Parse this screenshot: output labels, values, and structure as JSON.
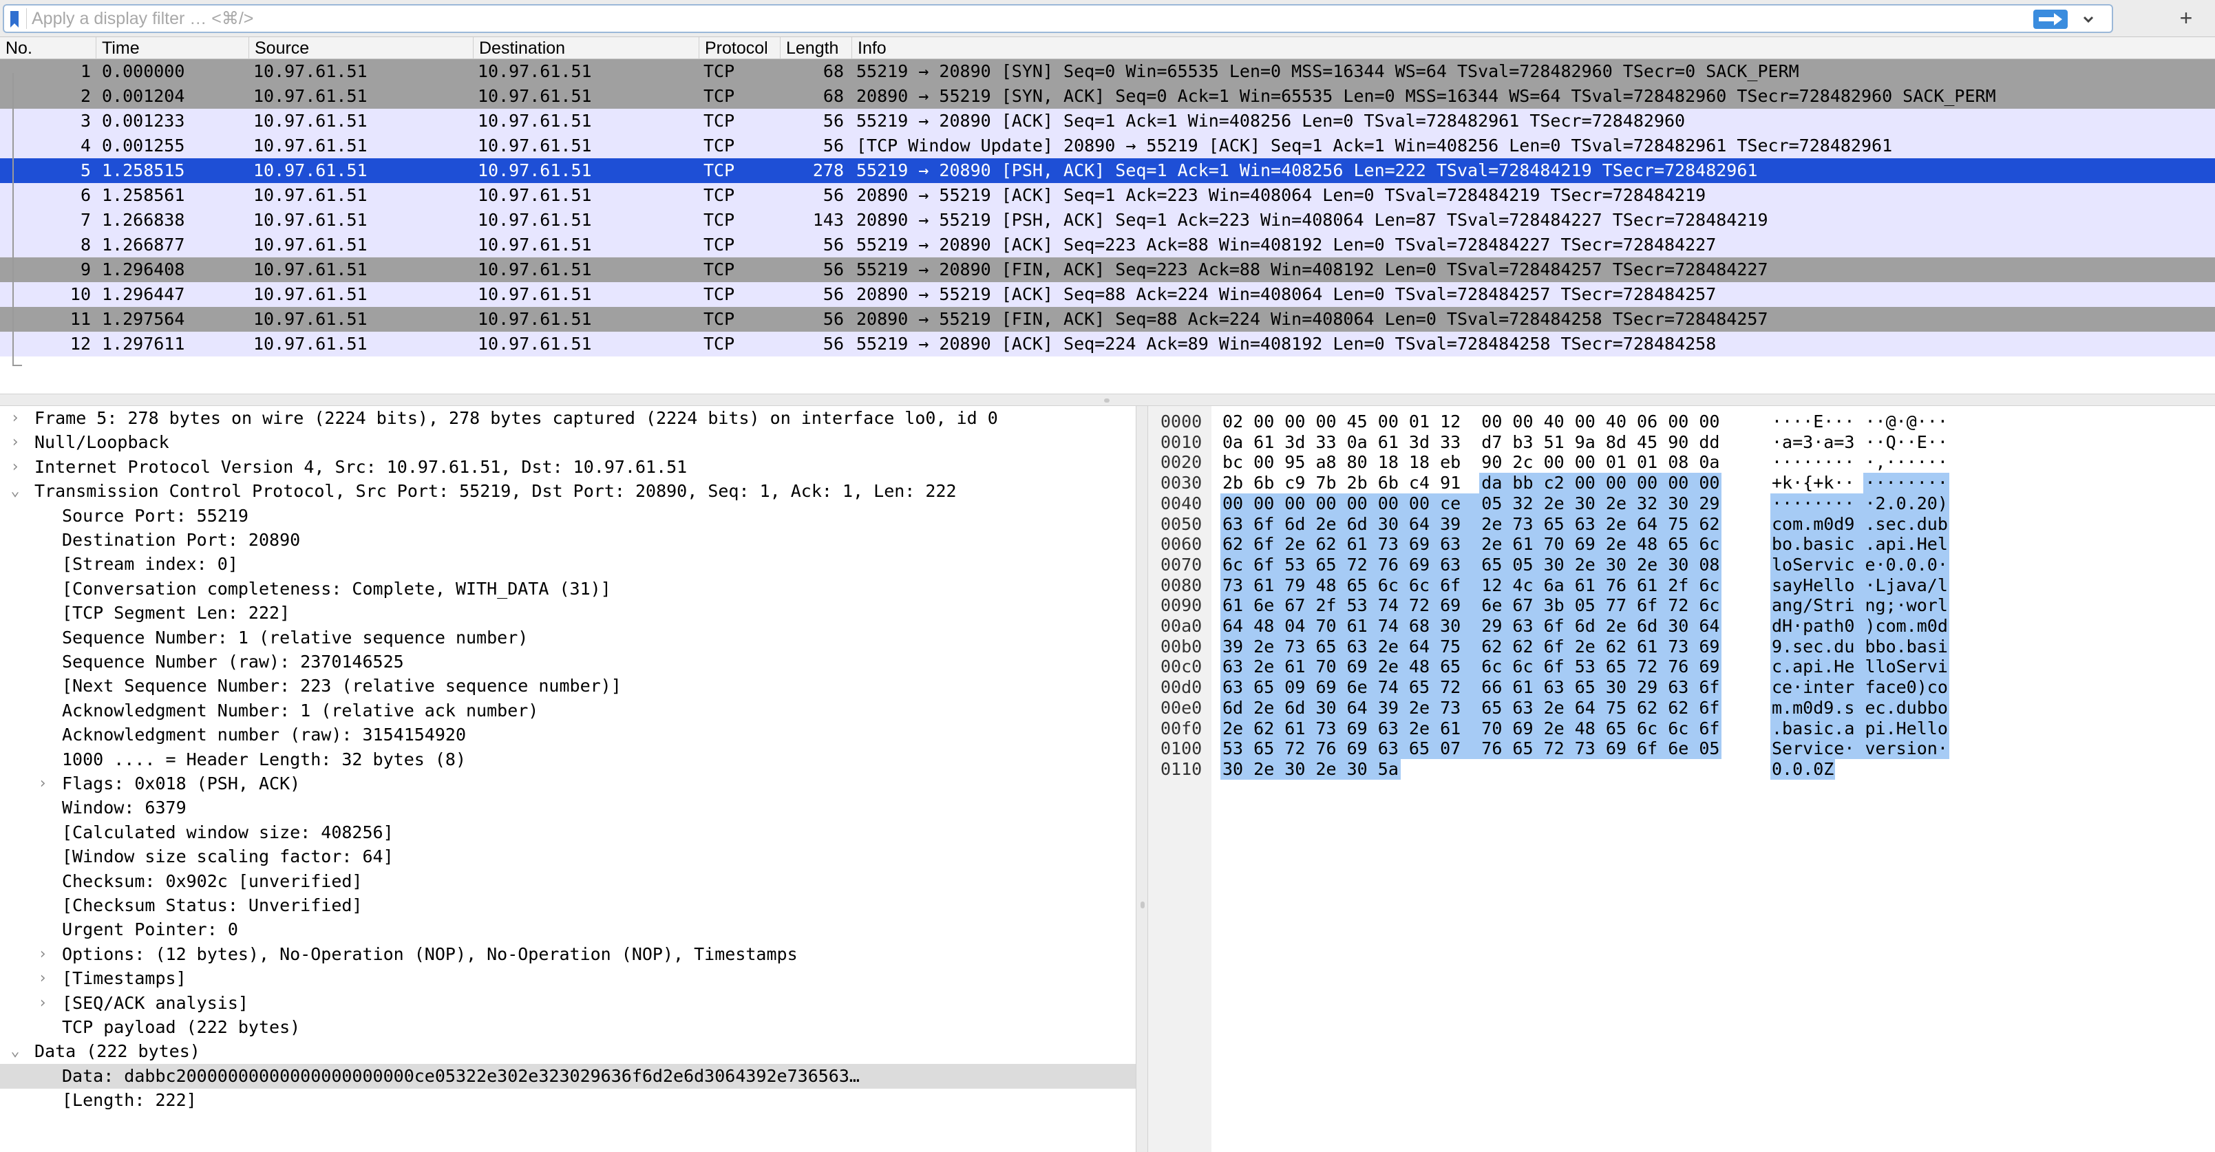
{
  "filter": {
    "placeholder": "Apply a display filter … <⌘/>",
    "add_label": "+"
  },
  "packet_list": {
    "columns": [
      "No.",
      "Time",
      "Source",
      "Destination",
      "Protocol",
      "Length",
      "Info"
    ],
    "selected_index": 4,
    "colors": {
      "gray_row": "#a0a0a0",
      "lavender_row": "#e7e6ff",
      "selected_row": "#1e4fd6",
      "selected_text": "#ffffff"
    },
    "rows": [
      {
        "no": "1",
        "time": "0.000000",
        "src": "10.97.61.51",
        "dst": "10.97.61.51",
        "proto": "TCP",
        "len": "68",
        "info": "55219 → 20890 [SYN] Seq=0 Win=65535 Len=0 MSS=16344 WS=64 TSval=728482960 TSecr=0 SACK_PERM",
        "style": "gray"
      },
      {
        "no": "2",
        "time": "0.001204",
        "src": "10.97.61.51",
        "dst": "10.97.61.51",
        "proto": "TCP",
        "len": "68",
        "info": "20890 → 55219 [SYN, ACK] Seq=0 Ack=1 Win=65535 Len=0 MSS=16344 WS=64 TSval=728482960 TSecr=728482960 SACK_PERM",
        "style": "gray"
      },
      {
        "no": "3",
        "time": "0.001233",
        "src": "10.97.61.51",
        "dst": "10.97.61.51",
        "proto": "TCP",
        "len": "56",
        "info": "55219 → 20890 [ACK] Seq=1 Ack=1 Win=408256 Len=0 TSval=728482961 TSecr=728482960",
        "style": "lavender"
      },
      {
        "no": "4",
        "time": "0.001255",
        "src": "10.97.61.51",
        "dst": "10.97.61.51",
        "proto": "TCP",
        "len": "56",
        "info": "[TCP Window Update] 20890 → 55219 [ACK] Seq=1 Ack=1 Win=408256 Len=0 TSval=728482961 TSecr=728482961",
        "style": "lavender"
      },
      {
        "no": "5",
        "time": "1.258515",
        "src": "10.97.61.51",
        "dst": "10.97.61.51",
        "proto": "TCP",
        "len": "278",
        "info": "55219 → 20890 [PSH, ACK] Seq=1 Ack=1 Win=408256 Len=222 TSval=728484219 TSecr=728482961",
        "style": "selected"
      },
      {
        "no": "6",
        "time": "1.258561",
        "src": "10.97.61.51",
        "dst": "10.97.61.51",
        "proto": "TCP",
        "len": "56",
        "info": "20890 → 55219 [ACK] Seq=1 Ack=223 Win=408064 Len=0 TSval=728484219 TSecr=728484219",
        "style": "lavender"
      },
      {
        "no": "7",
        "time": "1.266838",
        "src": "10.97.61.51",
        "dst": "10.97.61.51",
        "proto": "TCP",
        "len": "143",
        "info": "20890 → 55219 [PSH, ACK] Seq=1 Ack=223 Win=408064 Len=87 TSval=728484227 TSecr=728484219",
        "style": "lavender"
      },
      {
        "no": "8",
        "time": "1.266877",
        "src": "10.97.61.51",
        "dst": "10.97.61.51",
        "proto": "TCP",
        "len": "56",
        "info": "55219 → 20890 [ACK] Seq=223 Ack=88 Win=408192 Len=0 TSval=728484227 TSecr=728484227",
        "style": "lavender"
      },
      {
        "no": "9",
        "time": "1.296408",
        "src": "10.97.61.51",
        "dst": "10.97.61.51",
        "proto": "TCP",
        "len": "56",
        "info": "55219 → 20890 [FIN, ACK] Seq=223 Ack=88 Win=408192 Len=0 TSval=728484257 TSecr=728484227",
        "style": "gray"
      },
      {
        "no": "10",
        "time": "1.296447",
        "src": "10.97.61.51",
        "dst": "10.97.61.51",
        "proto": "TCP",
        "len": "56",
        "info": "20890 → 55219 [ACK] Seq=88 Ack=224 Win=408064 Len=0 TSval=728484257 TSecr=728484257",
        "style": "lavender"
      },
      {
        "no": "11",
        "time": "1.297564",
        "src": "10.97.61.51",
        "dst": "10.97.61.51",
        "proto": "TCP",
        "len": "56",
        "info": "20890 → 55219 [FIN, ACK] Seq=88 Ack=224 Win=408064 Len=0 TSval=728484258 TSecr=728484257",
        "style": "gray"
      },
      {
        "no": "12",
        "time": "1.297611",
        "src": "10.97.61.51",
        "dst": "10.97.61.51",
        "proto": "TCP",
        "len": "56",
        "info": "55219 → 20890 [ACK] Seq=224 Ack=89 Win=408192 Len=0 TSval=728484258 TSecr=728484258",
        "style": "lavender"
      }
    ]
  },
  "details": [
    {
      "text": "Frame 5: 278 bytes on wire (2224 bits), 278 bytes captured (2224 bits) on interface lo0, id 0",
      "level": 0,
      "arrow": "›"
    },
    {
      "text": "Null/Loopback",
      "level": 0,
      "arrow": "›"
    },
    {
      "text": "Internet Protocol Version 4, Src: 10.97.61.51, Dst: 10.97.61.51",
      "level": 0,
      "arrow": "›"
    },
    {
      "text": "Transmission Control Protocol, Src Port: 55219, Dst Port: 20890, Seq: 1, Ack: 1, Len: 222",
      "level": 0,
      "arrow": "⌄"
    },
    {
      "text": "Source Port: 55219",
      "level": 1,
      "arrow": ""
    },
    {
      "text": "Destination Port: 20890",
      "level": 1,
      "arrow": ""
    },
    {
      "text": "[Stream index: 0]",
      "level": 1,
      "arrow": ""
    },
    {
      "text": "[Conversation completeness: Complete, WITH_DATA (31)]",
      "level": 1,
      "arrow": ""
    },
    {
      "text": "[TCP Segment Len: 222]",
      "level": 1,
      "arrow": ""
    },
    {
      "text": "Sequence Number: 1    (relative sequence number)",
      "level": 1,
      "arrow": ""
    },
    {
      "text": "Sequence Number (raw): 2370146525",
      "level": 1,
      "arrow": ""
    },
    {
      "text": "[Next Sequence Number: 223    (relative sequence number)]",
      "level": 1,
      "arrow": ""
    },
    {
      "text": "Acknowledgment Number: 1    (relative ack number)",
      "level": 1,
      "arrow": ""
    },
    {
      "text": "Acknowledgment number (raw): 3154154920",
      "level": 1,
      "arrow": ""
    },
    {
      "text": "1000 .... = Header Length: 32 bytes (8)",
      "level": 1,
      "arrow": ""
    },
    {
      "text": "Flags: 0x018 (PSH, ACK)",
      "level": 1,
      "arrow": "›"
    },
    {
      "text": "Window: 6379",
      "level": 1,
      "arrow": ""
    },
    {
      "text": "[Calculated window size: 408256]",
      "level": 1,
      "arrow": ""
    },
    {
      "text": "[Window size scaling factor: 64]",
      "level": 1,
      "arrow": ""
    },
    {
      "text": "Checksum: 0x902c [unverified]",
      "level": 1,
      "arrow": ""
    },
    {
      "text": "[Checksum Status: Unverified]",
      "level": 1,
      "arrow": ""
    },
    {
      "text": "Urgent Pointer: 0",
      "level": 1,
      "arrow": ""
    },
    {
      "text": "Options: (12 bytes), No-Operation (NOP), No-Operation (NOP), Timestamps",
      "level": 1,
      "arrow": "›"
    },
    {
      "text": "[Timestamps]",
      "level": 1,
      "arrow": "›"
    },
    {
      "text": "[SEQ/ACK analysis]",
      "level": 1,
      "arrow": "›"
    },
    {
      "text": "TCP payload (222 bytes)",
      "level": 1,
      "arrow": ""
    },
    {
      "text": "Data (222 bytes)",
      "level": 0,
      "arrow": "⌄"
    },
    {
      "text": "Data: dabbc20000000000000000000000ce05322e302e323029636f6d2e6d3064392e736563…",
      "level": 1,
      "arrow": "",
      "selected": true
    },
    {
      "text": "[Length: 222]",
      "level": 1,
      "arrow": ""
    }
  ],
  "bytes": [
    {
      "off": "0000",
      "hex": "02 00 00 00 45 00 01 12  00 00 40 00 40 06 00 00",
      "ascii": "····E··· ··@·@···",
      "sel": 0
    },
    {
      "off": "0010",
      "hex": "0a 61 3d 33 0a 61 3d 33  d7 b3 51 9a 8d 45 90 dd",
      "ascii": "·a=3·a=3 ··Q··E··",
      "sel": 0
    },
    {
      "off": "0020",
      "hex": "bc 00 95 a8 80 18 18 eb  90 2c 00 00 01 01 08 0a",
      "ascii": "········ ·,······",
      "sel": 0
    },
    {
      "off": "0030",
      "hex": "2b 6b c9 7b 2b 6b c4 91  da bb c2 00 00 00 00 00",
      "ascii": "+k·{+k·· ········",
      "sel": 8
    },
    {
      "off": "0040",
      "hex": "00 00 00 00 00 00 00 ce  05 32 2e 30 2e 32 30 29",
      "ascii": "········ ·2.0.20)",
      "sel": 16
    },
    {
      "off": "0050",
      "hex": "63 6f 6d 2e 6d 30 64 39  2e 73 65 63 2e 64 75 62",
      "ascii": "com.m0d9 .sec.dub",
      "sel": 16
    },
    {
      "off": "0060",
      "hex": "62 6f 2e 62 61 73 69 63  2e 61 70 69 2e 48 65 6c",
      "ascii": "bo.basic .api.Hel",
      "sel": 16
    },
    {
      "off": "0070",
      "hex": "6c 6f 53 65 72 76 69 63  65 05 30 2e 30 2e 30 08",
      "ascii": "loServic e·0.0.0·",
      "sel": 16
    },
    {
      "off": "0080",
      "hex": "73 61 79 48 65 6c 6c 6f  12 4c 6a 61 76 61 2f 6c",
      "ascii": "sayHello ·Ljava/l",
      "sel": 16
    },
    {
      "off": "0090",
      "hex": "61 6e 67 2f 53 74 72 69  6e 67 3b 05 77 6f 72 6c",
      "ascii": "ang/Stri ng;·worl",
      "sel": 16
    },
    {
      "off": "00a0",
      "hex": "64 48 04 70 61 74 68 30  29 63 6f 6d 2e 6d 30 64",
      "ascii": "dH·path0 )com.m0d",
      "sel": 16
    },
    {
      "off": "00b0",
      "hex": "39 2e 73 65 63 2e 64 75  62 62 6f 2e 62 61 73 69",
      "ascii": "9.sec.du bbo.basi",
      "sel": 16
    },
    {
      "off": "00c0",
      "hex": "63 2e 61 70 69 2e 48 65  6c 6c 6f 53 65 72 76 69",
      "ascii": "c.api.He lloServi",
      "sel": 16
    },
    {
      "off": "00d0",
      "hex": "63 65 09 69 6e 74 65 72  66 61 63 65 30 29 63 6f",
      "ascii": "ce·inter face0)co",
      "sel": 16
    },
    {
      "off": "00e0",
      "hex": "6d 2e 6d 30 64 39 2e 73  65 63 2e 64 75 62 62 6f",
      "ascii": "m.m0d9.s ec.dubbo",
      "sel": 16
    },
    {
      "off": "00f0",
      "hex": "2e 62 61 73 69 63 2e 61  70 69 2e 48 65 6c 6c 6f",
      "ascii": ".basic.a pi.Hello",
      "sel": 16
    },
    {
      "off": "0100",
      "hex": "53 65 72 76 69 63 65 07  76 65 72 73 69 6f 6e 05",
      "ascii": "Service· version·",
      "sel": 16
    },
    {
      "off": "0110",
      "hex": "30 2e 30 2e 30 5a",
      "ascii": "0.0.0Z",
      "sel": 6
    }
  ]
}
